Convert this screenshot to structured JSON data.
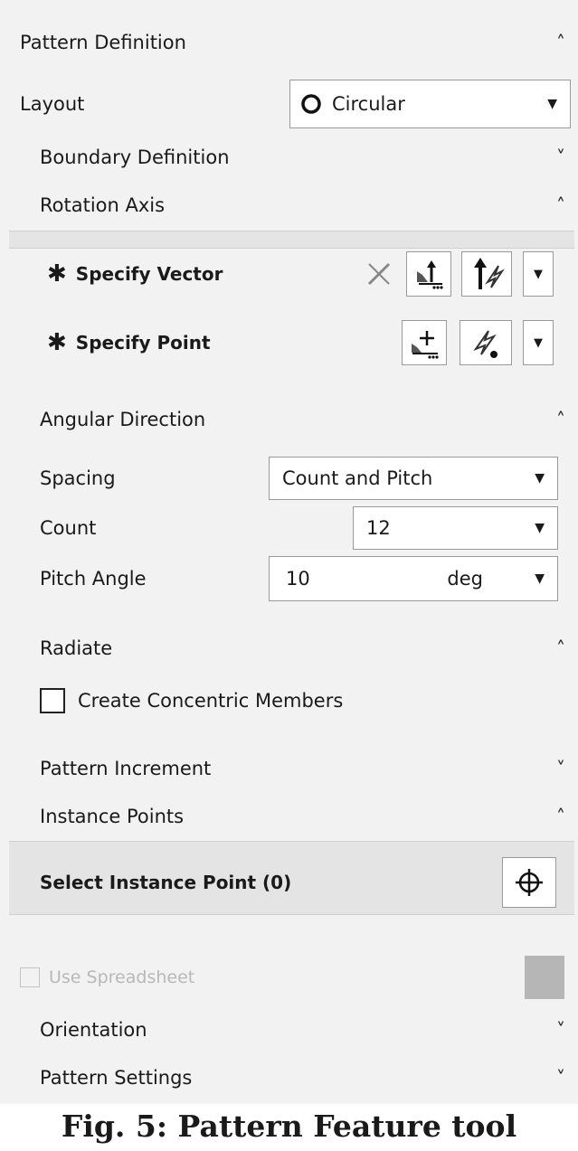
{
  "pattern_definition": {
    "title": "Pattern Definition"
  },
  "layout": {
    "label": "Layout",
    "value": "Circular"
  },
  "sections": {
    "boundary": "Boundary Definition",
    "rotation_axis": "Rotation Axis",
    "angular_direction": "Angular Direction",
    "radiate": "Radiate",
    "pattern_increment": "Pattern Increment",
    "instance_points": "Instance Points",
    "orientation": "Orientation",
    "pattern_settings": "Pattern Settings"
  },
  "rotation_axis": {
    "specify_vector": "Specify Vector",
    "specify_point": "Specify Point"
  },
  "angular": {
    "spacing_label": "Spacing",
    "spacing_value": "Count and Pitch",
    "count_label": "Count",
    "count_value": "12",
    "pitch_label": "Pitch Angle",
    "pitch_value": "10",
    "pitch_unit": "deg"
  },
  "radiate": {
    "checkbox_label": "Create Concentric Members",
    "checked": false
  },
  "instance_points": {
    "select_label": "Select Instance Point (0)"
  },
  "spreadsheet": {
    "label": "Use Spreadsheet",
    "enabled": false
  },
  "caption": "Fig. 5: Pattern Feature tool"
}
